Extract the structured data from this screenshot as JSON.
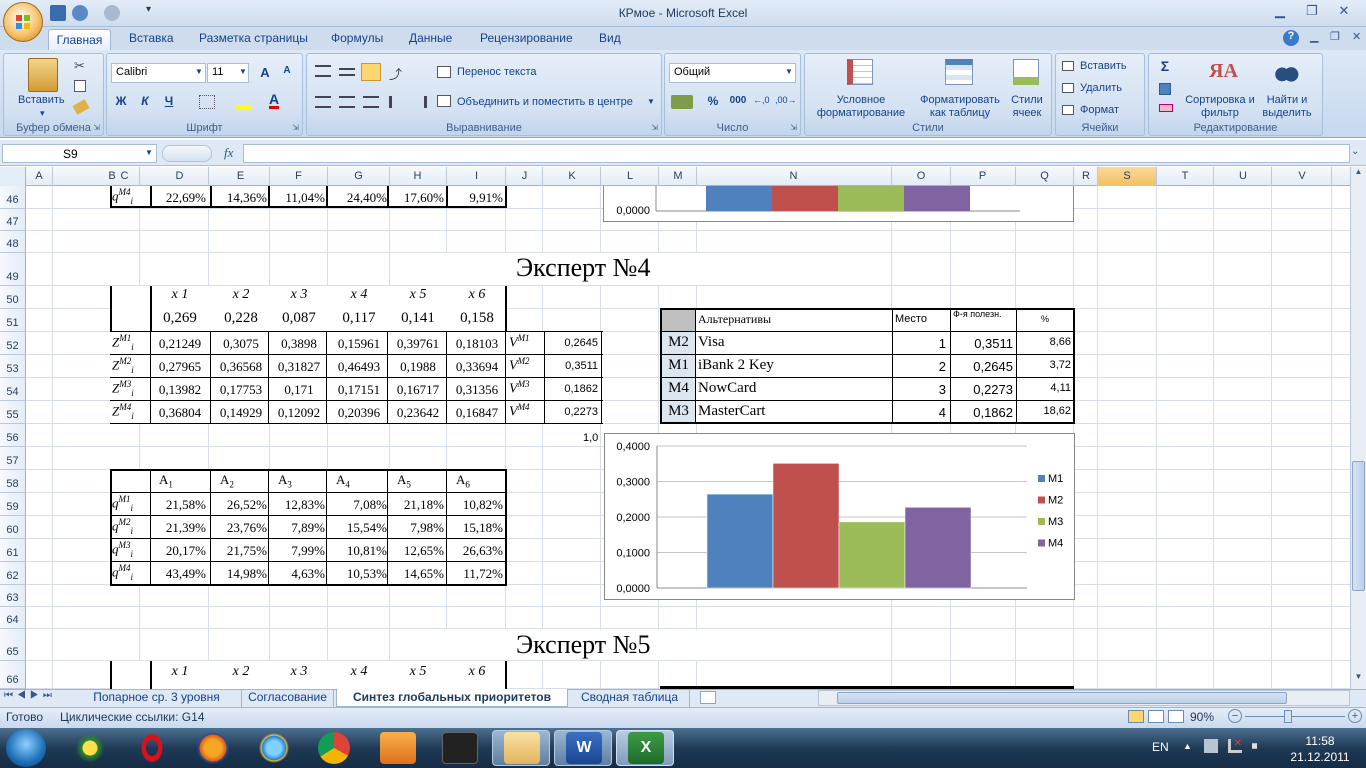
{
  "window": {
    "title": "КРмое - Microsoft Excel",
    "min": "▁",
    "restore": "❐",
    "close": "✕"
  },
  "tabs": [
    "Главная",
    "Вставка",
    "Разметка страницы",
    "Формулы",
    "Данные",
    "Рецензирование",
    "Вид"
  ],
  "ribbon": {
    "clipboard": {
      "paste": "Вставить",
      "label": "Буфер обмена"
    },
    "font": {
      "name": "Calibri",
      "size": "11",
      "bold": "Ж",
      "italic": "К",
      "underline": "Ч",
      "label": "Шрифт"
    },
    "align": {
      "wrap": "Перенос текста",
      "merge": "Объединить и поместить в центре",
      "label": "Выравнивание"
    },
    "number": {
      "format": "Общий",
      "percent": "%",
      "thousands": "000",
      "label": "Число"
    },
    "styles": {
      "cond": "Условное форматирование",
      "table": "Форматировать как таблицу",
      "cell": "Стили ячеек",
      "label": "Стили"
    },
    "cells": {
      "insert": "Вставить",
      "delete": "Удалить",
      "format": "Формат",
      "label": "Ячейки"
    },
    "editing": {
      "sum": "Σ",
      "sort": "Сортировка и фильтр",
      "find": "Найти и выделить",
      "label": "Редактирование"
    }
  },
  "formula": {
    "namebox": "S9",
    "fx": "fx",
    "content": ""
  },
  "columns": [
    "A",
    "B",
    "C",
    "D",
    "E",
    "F",
    "G",
    "H",
    "I",
    "J",
    "K",
    "L",
    "M",
    "N",
    "O",
    "P",
    "Q",
    "R",
    "S",
    "T",
    "U",
    "V"
  ],
  "rows": [
    "46",
    "47",
    "48",
    "49",
    "50",
    "51",
    "52",
    "53",
    "54",
    "55",
    "56",
    "57",
    "58",
    "59",
    "60",
    "61",
    "62",
    "63",
    "64",
    "65",
    "66"
  ],
  "row46": {
    "label": "q",
    "sup": "M4",
    "vals": [
      "22,69%",
      "14,36%",
      "11,04%",
      "24,40%",
      "17,60%",
      "9,91%"
    ]
  },
  "expert4": "Эксперт №4",
  "expert5": "Эксперт №5",
  "xheaders": [
    "x 1",
    "x 2",
    "x 3",
    "x 4",
    "x 5",
    "x 6"
  ],
  "weights": [
    "0,269",
    "0,228",
    "0,087",
    "0,117",
    "0,141",
    "0,158"
  ],
  "ztable": [
    {
      "lab": "Z",
      "sup": "M1",
      "vals": [
        "0,21249",
        "0,3075",
        "0,3898",
        "0,15961",
        "0,39761",
        "0,18103"
      ],
      "v": "V",
      "vsup": "M1",
      "vval": "0,2645"
    },
    {
      "lab": "Z",
      "sup": "M2",
      "vals": [
        "0,27965",
        "0,36568",
        "0,31827",
        "0,46493",
        "0,1988",
        "0,33694"
      ],
      "v": "V",
      "vsup": "M2",
      "vval": "0,3511"
    },
    {
      "lab": "Z",
      "sup": "M3",
      "vals": [
        "0,13982",
        "0,17753",
        "0,171",
        "0,17151",
        "0,16717",
        "0,31356"
      ],
      "v": "V",
      "vsup": "M3",
      "vval": "0,1862"
    },
    {
      "lab": "Z",
      "sup": "M4",
      "vals": [
        "0,36804",
        "0,14929",
        "0,12092",
        "0,20396",
        "0,23642",
        "0,16847"
      ],
      "v": "V",
      "vsup": "M4",
      "vval": "0,2273"
    }
  ],
  "atable": {
    "headers": [
      "A1",
      "A2",
      "A3",
      "A4",
      "A5",
      "A6"
    ],
    "rows": [
      {
        "lab": "q",
        "sup": "M1",
        "vals": [
          "21,58%",
          "26,52%",
          "12,83%",
          "7,08%",
          "21,18%",
          "10,82%"
        ]
      },
      {
        "lab": "q",
        "sup": "M2",
        "vals": [
          "21,39%",
          "23,76%",
          "7,89%",
          "15,54%",
          "7,98%",
          "15,18%"
        ]
      },
      {
        "lab": "q",
        "sup": "M3",
        "vals": [
          "20,17%",
          "21,75%",
          "7,99%",
          "10,81%",
          "12,65%",
          "26,63%"
        ]
      },
      {
        "lab": "q",
        "sup": "M4",
        "vals": [
          "43,49%",
          "14,98%",
          "4,63%",
          "10,53%",
          "14,65%",
          "11,72%"
        ]
      }
    ]
  },
  "alt": {
    "headers": [
      "Альтернативы",
      "Место",
      "Ф-я полезн.",
      "%"
    ],
    "rows": [
      {
        "id": "M2",
        "name": "Visa",
        "place": "1",
        "util": "0,3511",
        "pct": "8,66"
      },
      {
        "id": "M1",
        "name": "iBank 2 Key",
        "place": "2",
        "util": "0,2645",
        "pct": "3,72"
      },
      {
        "id": "M4",
        "name": "NowCard",
        "place": "3",
        "util": "0,2273",
        "pct": "4,11"
      },
      {
        "id": "M3",
        "name": "MasterCart",
        "place": "4",
        "util": "0,1862",
        "pct": "18,62"
      }
    ]
  },
  "stray": "1,0",
  "chart_data": [
    {
      "type": "bar",
      "categories": [
        ""
      ],
      "series": [
        {
          "name": "M1",
          "values": [
            null
          ]
        },
        {
          "name": "M2",
          "values": [
            null
          ]
        },
        {
          "name": "M3",
          "values": [
            null
          ]
        },
        {
          "name": "M4",
          "values": [
            null
          ]
        }
      ],
      "yticks": [
        "0,0000"
      ],
      "legend": "none"
    },
    {
      "type": "bar",
      "categories": [
        ""
      ],
      "series": [
        {
          "name": "M1",
          "values": [
            0.2645
          ]
        },
        {
          "name": "M2",
          "values": [
            0.3511
          ]
        },
        {
          "name": "M3",
          "values": [
            0.1862
          ]
        },
        {
          "name": "M4",
          "values": [
            0.2273
          ]
        }
      ],
      "ylim": [
        0,
        0.4
      ],
      "yticks": [
        "0,0000",
        "0,1000",
        "0,2000",
        "0,3000",
        "0,4000"
      ],
      "legend": "right",
      "grid": true
    }
  ],
  "colors": {
    "M1": "#4f81bd",
    "M2": "#c0504d",
    "M3": "#9bbb59",
    "M4": "#8064a2"
  },
  "sheets": [
    "Попарное ср. 3 уровня",
    "Согласование",
    "Синтез глобальных приоритетов",
    "Сводная таблица"
  ],
  "status": {
    "ready": "Готово",
    "cyclic": "Циклические ссылки: G14",
    "zoom": "90%"
  },
  "tray": {
    "lang": "EN",
    "time": "11:58",
    "date": "21.12.2011"
  }
}
